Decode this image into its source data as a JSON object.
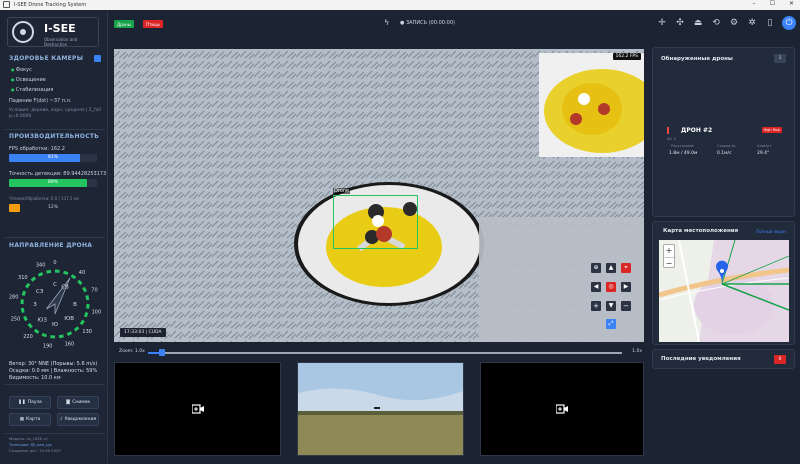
{
  "window": {
    "title": "I-SEE Drone Tracking System",
    "controls": [
      "–",
      "☐",
      "✕"
    ]
  },
  "app": {
    "name": "I-SEE",
    "subtitle": "Observation and Destruction"
  },
  "camera_health": {
    "title": "ЗДОРОВЬЕ КАМЕРЫ",
    "items": [
      "Фокус",
      "Освещение",
      "Стабилизация"
    ],
    "fall": "Падение F(dst) ~37 п.л.",
    "conditions": "Условия: дерево, корн, средняя | Σ_fall p=0.0000"
  },
  "performance": {
    "title": "ПРОИЗВОДИТЕЛЬНОСТЬ",
    "fps_label": "FPS обработки: 162.2",
    "fps_pct": "81%",
    "fps_fill": 0.81,
    "accuracy_label": "Точность детекции: 89.94428253173",
    "accuracy_pct": "89%",
    "accuracy_fill": 0.89,
    "queue_label": "Чтение/Обработка: 0.0 / 137.5 мс",
    "queue_pct": "12%",
    "queue_fill": 0.12,
    "colors": {
      "fps": "#3b82f6",
      "accuracy": "#22c55e",
      "queue": "#f59e0b"
    }
  },
  "direction": {
    "title": "НАПРАВЛЕНИЕ ДРОНА",
    "labels": [
      {
        "t": "СВ",
        "deg": 30
      },
      {
        "t": "В",
        "deg": 90
      },
      {
        "t": "ЮВ",
        "deg": 135
      },
      {
        "t": "Ю",
        "deg": 180
      },
      {
        "t": "ЮЗ",
        "deg": 220
      },
      {
        "t": "З",
        "deg": 270
      },
      {
        "t": "СЗ",
        "deg": 310
      },
      {
        "t": "С",
        "deg": 0
      }
    ],
    "ticks": [
      {
        "t": "40",
        "deg": 40
      },
      {
        "t": "70",
        "deg": 70
      },
      {
        "t": "100",
        "deg": 100
      },
      {
        "t": "130",
        "deg": 130
      },
      {
        "t": "160",
        "deg": 160
      },
      {
        "t": "190",
        "deg": 190
      },
      {
        "t": "220",
        "deg": 220
      },
      {
        "t": "250",
        "deg": 250
      },
      {
        "t": "280",
        "deg": 280
      },
      {
        "t": "310",
        "deg": 310
      },
      {
        "t": "340",
        "deg": 340
      },
      {
        "t": "0",
        "deg": 0
      }
    ],
    "heading_deg": 30
  },
  "weather": {
    "wind": "Ветер: 30° NNE (Порывы: 5.6 m/s)",
    "clouds": "Осадки: 0.0 мм | Влажность: 59%",
    "visibility": "Видимость: 10.0 км"
  },
  "actions": {
    "pause": "Пауза",
    "snapshot": "Снимок",
    "map": "Карта",
    "notifications": "Уведомления"
  },
  "footer": {
    "line1": "Модель: ss_i-SEE.v1",
    "line2": "Телеграм: @i_see_sys",
    "line3": "Создание дат: 15.09.2025"
  },
  "topbar": {
    "chip_drones": "Дроны",
    "chip_birds": "Птицы",
    "recording": "● ЗАПИСЬ (00:00:00)"
  },
  "video": {
    "fps": "162.2 FPS",
    "timestamp": "17:33:03 | CUDA",
    "detection_label": "Drone"
  },
  "zoom": {
    "label": "Zoom: 1.0x",
    "max": "1.0x",
    "level": 0.03
  },
  "detected": {
    "title": "Обнаруженные дроны",
    "count": "1",
    "drone_name": "ДРОН #2",
    "threat": "High Risk",
    "id": "ID: 2",
    "distance_label": "Расстояние",
    "distance_value": "1.8м / 49.0м",
    "speed_label": "Скорость",
    "speed_value": "0.1м/с",
    "azimuth_label": "Азимут",
    "azimuth_value": "29.4°"
  },
  "map": {
    "title": "Карта местоположения",
    "link": "Полный экран"
  },
  "notifications": {
    "title": "Последние уведомления",
    "count": "0"
  }
}
